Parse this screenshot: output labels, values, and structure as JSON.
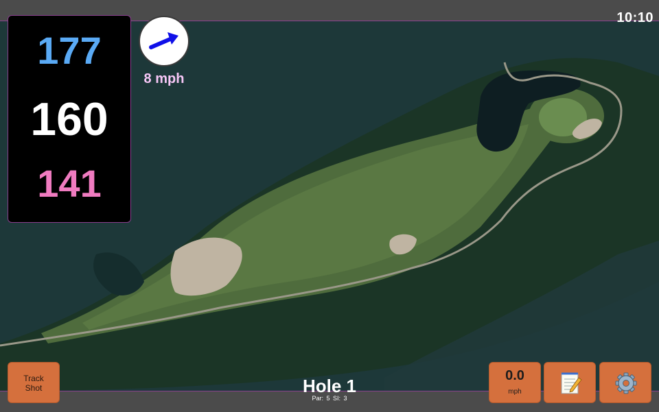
{
  "status": {
    "time": "10:10"
  },
  "yardages": {
    "back": "177",
    "middle": "160",
    "front": "141"
  },
  "wind": {
    "speed": "8 mph",
    "icon": "wind-arrow-icon",
    "direction": "north-east"
  },
  "hole": {
    "title": "Hole 1",
    "par_label": "Par: 5",
    "si_label": "SI: 3"
  },
  "controls": {
    "track_shot_line1": "Track",
    "track_shot_line2": "Shot",
    "speed_value": "0.0",
    "speed_unit": "mph",
    "notes_icon": "notepad-icon",
    "settings_icon": "gear-icon"
  },
  "colors": {
    "back_distance": "#5aaaf5",
    "middle_distance": "#ffffff",
    "front_distance": "#f07bc0",
    "button": "#d5703d",
    "accent_border": "#8a3f8f"
  }
}
